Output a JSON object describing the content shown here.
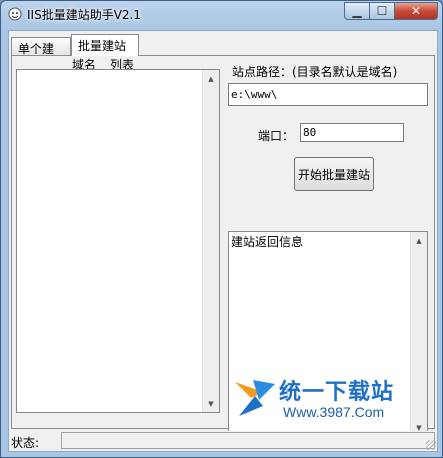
{
  "window": {
    "title": "IIS批量建站助手V2.1"
  },
  "tabs": [
    {
      "label": "单个建站"
    },
    {
      "label": "批量建站"
    }
  ],
  "list": {
    "header_col1": "域名",
    "header_col2": "列表",
    "items": []
  },
  "path": {
    "label": "站点路径：(目录名默认是域名)",
    "value": "e:\\www\\"
  },
  "port": {
    "label": "端口：",
    "value": "80"
  },
  "start_button": {
    "label": "开始批量建站"
  },
  "info": {
    "text": "建站返回信息"
  },
  "watermark": {
    "cn": "统一下载站",
    "url": "Www.3987.Com"
  },
  "status": {
    "label": "状态:",
    "text": ""
  }
}
